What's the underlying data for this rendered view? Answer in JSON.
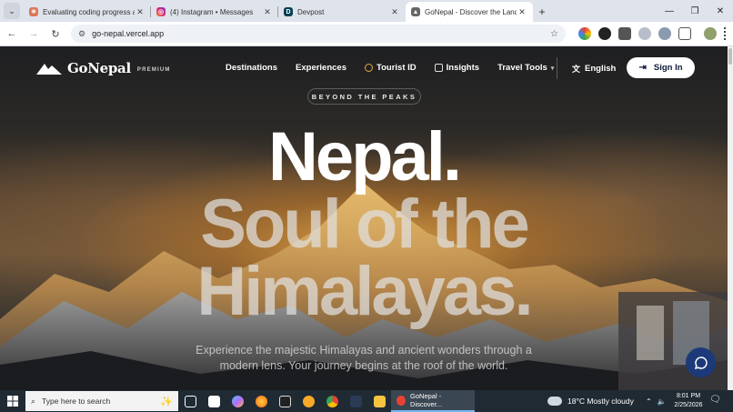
{
  "browser": {
    "tabs": [
      {
        "title": "Evaluating coding progress as a",
        "icon": "claude-icon",
        "color": "#d97757",
        "active": false
      },
      {
        "title": "(4) Instagram • Messages",
        "icon": "instagram-icon",
        "color": "#e1306c",
        "active": false
      },
      {
        "title": "Devpost",
        "icon": "devpost-icon",
        "color": "#003e54",
        "active": false
      },
      {
        "title": "GoNepal - Discover the Land of",
        "icon": "mountain-icon",
        "color": "#444444",
        "active": true
      }
    ],
    "url": "go-nepal.vercel.app"
  },
  "site": {
    "brand": "GoNepal",
    "badge": "PREMIUM",
    "nav": {
      "destinations": "Destinations",
      "experiences": "Experiences",
      "tourist_id": "Tourist ID",
      "insights": "Insights",
      "travel_tools": "Travel Tools"
    },
    "language": "English",
    "sign_in": "Sign In",
    "eyebrow": "BEYOND THE PEAKS",
    "headline": {
      "line1": "Nepal.",
      "line2": "Soul of the",
      "line3": "Himalayas."
    },
    "subtitle": "Experience the majestic Himalayas and ancient wonders through a modern lens. Your journey begins at the roof of the world."
  },
  "taskbar": {
    "search_placeholder": "Type here to search",
    "active_app": "GoNepal - Discover...",
    "weather": "18°C  Mostly cloudy",
    "time": "8:01 PM",
    "date": "2/25/2026"
  },
  "colors": {
    "accent_gold": "#e8a93a",
    "signin_text": "#0e1a3a",
    "chat_button": "#1c3a7a"
  }
}
